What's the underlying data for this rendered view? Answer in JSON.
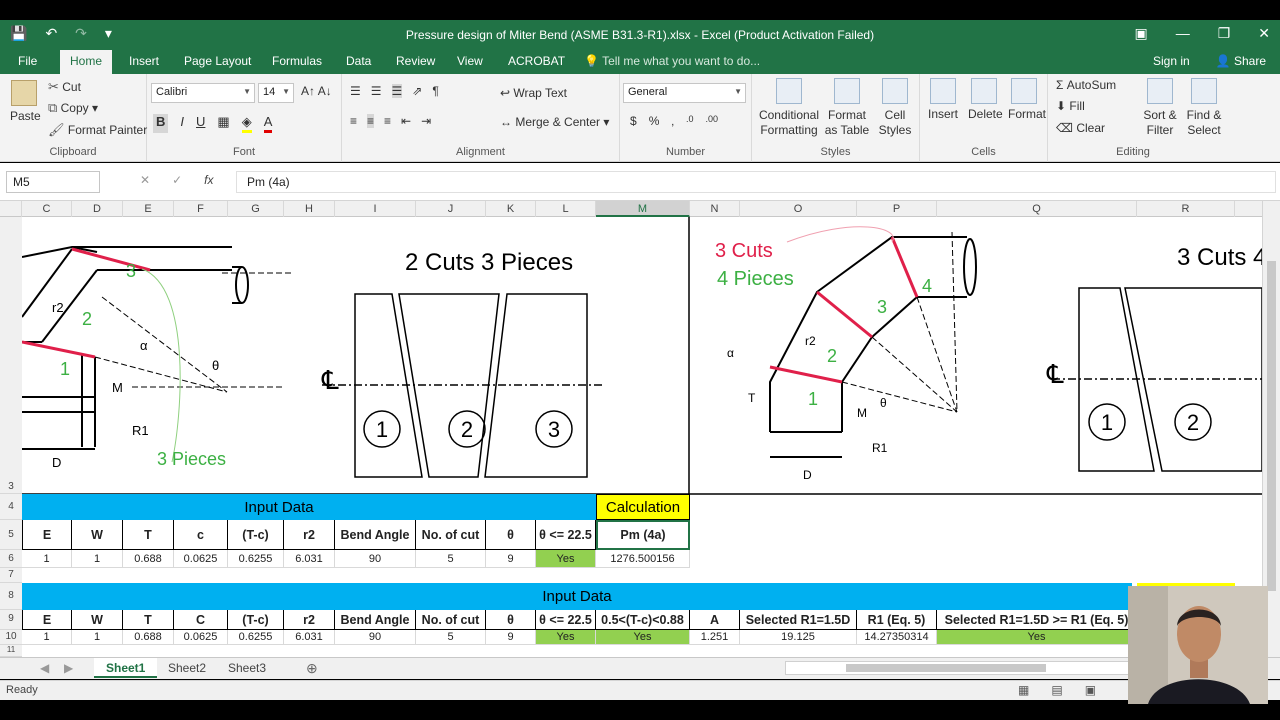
{
  "window": {
    "title": "Pressure design of Miter Bend (ASME B31.3-R1).xlsx - Excel (Product Activation Failed)",
    "sign_in": "Sign in",
    "share": "Share"
  },
  "ribbon_tabs": [
    "File",
    "Home",
    "Insert",
    "Page Layout",
    "Formulas",
    "Data",
    "Review",
    "View",
    "ACROBAT"
  ],
  "tell_me": "Tell me what you want to do...",
  "clipboard": {
    "paste": "Paste",
    "cut": "Cut",
    "copy": "Copy",
    "format_painter": "Format Painter",
    "label": "Clipboard"
  },
  "font": {
    "name": "Calibri",
    "size": "14",
    "label": "Font"
  },
  "alignment": {
    "wrap_text": "Wrap Text",
    "merge_center": "Merge & Center",
    "label": "Alignment"
  },
  "number": {
    "format": "General",
    "label": "Number"
  },
  "styles": {
    "conditional": "Conditional Formatting",
    "format_table": "Format as Table",
    "cell_styles": "Cell Styles",
    "label": "Styles"
  },
  "cells": {
    "insert": "Insert",
    "delete": "Delete",
    "format": "Format",
    "label": "Cells"
  },
  "editing": {
    "autosum": "AutoSum",
    "fill": "Fill",
    "clear": "Clear",
    "sort_filter": "Sort & Filter",
    "find_select": "Find & Select",
    "label": "Editing"
  },
  "formula_bar": {
    "name_box": "M5",
    "fx": "fx",
    "content": "Pm (4a)"
  },
  "columns": [
    "C",
    "D",
    "E",
    "F",
    "G",
    "H",
    "I",
    "J",
    "K",
    "L",
    "M",
    "N",
    "O",
    "P",
    "Q",
    "R"
  ],
  "rows": [
    "3",
    "4",
    "5",
    "6",
    "7",
    "8",
    "9",
    "10",
    "11"
  ],
  "figures": {
    "left_title": "2 Cuts 3 Pieces",
    "left_pieces": [
      "1",
      "2",
      "3"
    ],
    "left_label": "3 Pieces",
    "right_title": "3 Cuts 4",
    "right_annot_cuts": "3 Cuts",
    "right_annot_pieces": "4 Pieces",
    "right_pieces": [
      "1",
      "2"
    ],
    "bend_numbers_left": [
      "1",
      "2",
      "3"
    ],
    "bend_numbers_right": [
      "1",
      "2",
      "3",
      "4"
    ],
    "dim_labels": [
      "r2",
      "α",
      "θ",
      "M",
      "T",
      "R1",
      "D"
    ]
  },
  "table1": {
    "input_banner": "Input Data",
    "calc_banner": "Calculation",
    "headers": [
      "E",
      "W",
      "T",
      "c",
      "(T-c)",
      "r2",
      "Bend Angle",
      "No. of cut",
      "θ",
      "θ <= 22.5",
      "Pm (4a)"
    ],
    "values": [
      "1",
      "1",
      "0.688",
      "0.0625",
      "0.6255",
      "6.031",
      "90",
      "5",
      "9",
      "Yes",
      "1276.500156"
    ]
  },
  "table2": {
    "input_banner": "Input Data",
    "headers": [
      "E",
      "W",
      "T",
      "C",
      "(T-c)",
      "r2",
      "Bend Angle",
      "No. of cut",
      "θ",
      "θ <= 22.5",
      "0.5<(T-c)<0.88",
      "A",
      "Selected R1=1.5D",
      "R1 (Eq. 5)",
      "Selected R1=1.5D >= R1 (Eq. 5)"
    ],
    "values": [
      "1",
      "1",
      "0.688",
      "0.0625",
      "0.6255",
      "6.031",
      "90",
      "5",
      "9",
      "Yes",
      "Yes",
      "1.251",
      "19.125",
      "14.27350314",
      "Yes"
    ]
  },
  "sheets": [
    "Sheet1",
    "Sheet2",
    "Sheet3"
  ],
  "status": "Ready",
  "colors": {
    "excel_green": "#217346",
    "banner_blue": "#00b0f0",
    "yes_green": "#92d050",
    "calc_yellow": "#ffff00",
    "cut_red": "#e0204a",
    "annot_green": "#3cb043"
  }
}
